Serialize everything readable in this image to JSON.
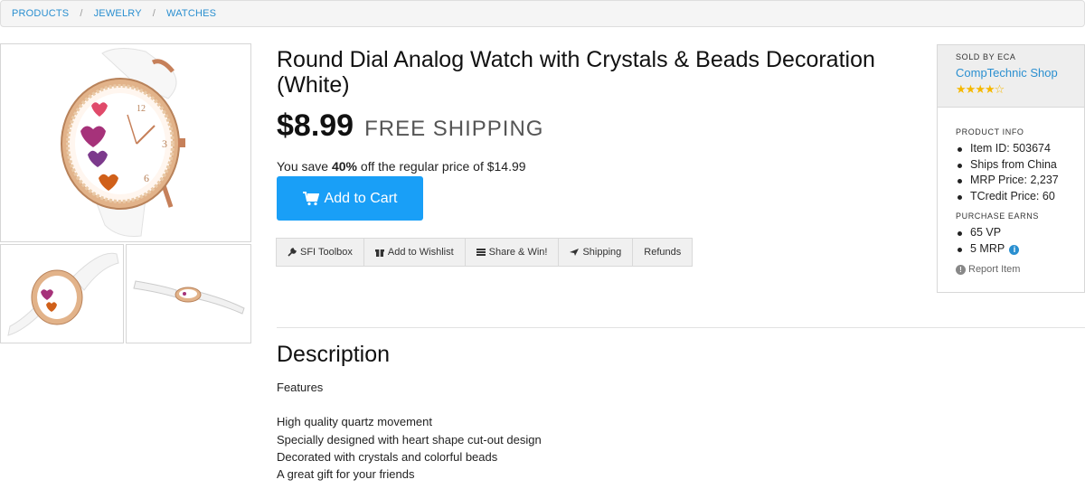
{
  "breadcrumb": [
    "PRODUCTS",
    "JEWELRY",
    "WATCHES"
  ],
  "product": {
    "title": "Round Dial Analog Watch with Crystals & Beads Decoration (White)",
    "price": "$8.99",
    "shipping": "FREE SHIPPING",
    "savings_prefix": "You save ",
    "savings_pct": "40%",
    "savings_suffix": " off the regular price of $14.99"
  },
  "cart_button": {
    "label": "Add to Cart",
    "icon": "cart-icon"
  },
  "toolbar": [
    {
      "label": "SFI Toolbox",
      "icon": "wrench-icon"
    },
    {
      "label": "Add to Wishlist",
      "icon": "gift-icon"
    },
    {
      "label": "Share & Win!",
      "icon": "list-icon"
    },
    {
      "label": "Shipping",
      "icon": "plane-icon"
    },
    {
      "label": "Refunds",
      "icon": ""
    }
  ],
  "description": {
    "heading": "Description",
    "lines": [
      "Features",
      "",
      "High quality quartz movement",
      "Specially designed with heart shape cut-out design",
      "Decorated with crystals and colorful beads",
      "A great gift for your friends"
    ]
  },
  "seller": {
    "sold_by_label": "SOLD BY ECA",
    "shop_name": "CompTechnic Shop",
    "rating": 4,
    "rating_max": 5
  },
  "product_info": {
    "label": "PRODUCT INFO",
    "items": [
      "Item ID: 503674",
      "Ships from China",
      "MRP Price: 2,237",
      "TCredit Price: 60"
    ]
  },
  "purchase_earns": {
    "label": "PURCHASE EARNS",
    "items": [
      "65 VP",
      "5 MRP"
    ]
  },
  "report_label": "Report Item",
  "colors": {
    "accent": "#199ff7",
    "link": "#2a8fd0",
    "star": "#f5b800"
  }
}
